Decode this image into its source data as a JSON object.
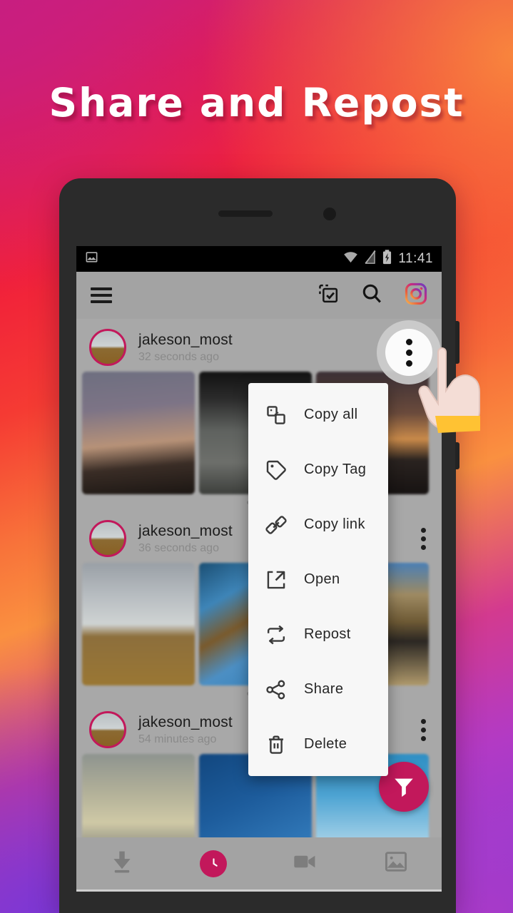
{
  "promo": {
    "headline": "Share and Repost",
    "background_colors": {
      "magenta": "#c9207f",
      "red": "#f1213a",
      "orange": "#fa9040",
      "purple": "#7436d6",
      "violet": "#b33ac4"
    }
  },
  "theme": {
    "accent": "#c2185b",
    "screen_bg": "#a8a8a8",
    "toolbar_bg": "#a3a3a3",
    "menu_bg": "#f7f7f7",
    "statusbar_bg": "#000000"
  },
  "statusbar": {
    "time": "11:41",
    "left_icons": [
      {
        "name": "image-notification-icon",
        "glyph": "image"
      }
    ],
    "right_icons": [
      {
        "name": "wifi-icon",
        "glyph": "wifi"
      },
      {
        "name": "signal-off-icon",
        "glyph": "signal-slash"
      },
      {
        "name": "battery-charging-icon",
        "glyph": "battery-bolt"
      }
    ]
  },
  "toolbar": {
    "menu_label": "Menu",
    "actions": [
      {
        "name": "select-all-icon",
        "label": "Select all"
      },
      {
        "name": "search-icon",
        "label": "Search"
      },
      {
        "name": "instagram-icon",
        "label": "Instagram"
      }
    ]
  },
  "feed": {
    "posts": [
      {
        "username": "jakeson_most",
        "time": "32 seconds ago",
        "thumbnails": [
          {
            "name": "thumb-powerlines-dusk",
            "css": "linear-gradient(175deg,#6e6f80 0%,#7d7486 30%,#b79278 58%,#3a2d26 76%,#1b1613 100%)"
          },
          {
            "name": "thumb-dark-grey",
            "css": "linear-gradient(180deg,#131313 0%,#2b2b2b 22%,#5f625f 48%,#6d6f6b 74%,#3d3f3c 100%)"
          },
          {
            "name": "thumb-sunset-road",
            "css": "linear-gradient(180deg,#3b3036 0%,#6b4b3c 34%,#c98a4a 55%,#2a2320 72%,#171312 100%)"
          }
        ]
      },
      {
        "username": "jakeson_most",
        "time": "36 seconds ago",
        "thumbnails": [
          {
            "name": "thumb-beach-desert",
            "css": "linear-gradient(180deg,#9aa0a6 0%,#b9bec2 28%,#cfd3d3 50%,#8d6f3c 60%,#9a7734 100%)"
          },
          {
            "name": "thumb-tree-blue-sky",
            "css": "linear-gradient(150deg,#1b4f74 0%,#3e85b8 26%,#7a5a2c 46%,#4c8fc4 66%,#2f7bb3 100%)"
          },
          {
            "name": "thumb-desert-dune",
            "css": "linear-gradient(180deg,#4a7fb5 0%,#9e8a62 26%,#6e5a35 48%,#2b2723 64%,#b09a6c 100%)"
          }
        ]
      },
      {
        "username": "jakeson_most",
        "time": "54 minutes ago",
        "thumbnails": [
          {
            "name": "thumb-hazy-sky",
            "css": "linear-gradient(180deg,#8e948f 0%,#b3b199 32%,#cfc9a6 56%,#7d7f79 82%,#55554f 100%)"
          },
          {
            "name": "thumb-deep-blue",
            "css": "linear-gradient(155deg,#12477f 0%,#1d5c9c 40%,#2e74b4 72%,#3c84c2 100%)"
          },
          {
            "name": "thumb-clouds-blue",
            "css": "linear-gradient(180deg,#2f8fc4 0%,#4ea4d3 34%,#8ec6e3 62%,#bfdceb 84%,#6fb2d8 100%)"
          }
        ]
      }
    ]
  },
  "popup_menu": {
    "items": [
      {
        "label": "Copy all",
        "icon": "copy-all-icon"
      },
      {
        "label": "Copy Tag",
        "icon": "tag-icon"
      },
      {
        "label": "Copy link",
        "icon": "link-icon"
      },
      {
        "label": "Open",
        "icon": "open-external-icon"
      },
      {
        "label": "Repost",
        "icon": "repost-icon"
      },
      {
        "label": "Share",
        "icon": "share-icon"
      },
      {
        "label": "Delete",
        "icon": "trash-icon"
      }
    ]
  },
  "fab": {
    "name": "filter-fab",
    "label": "Filter"
  },
  "bottomnav": {
    "items": [
      {
        "name": "nav-downloads",
        "label": "Downloads",
        "icon": "download-icon",
        "active": false
      },
      {
        "name": "nav-history",
        "label": "History",
        "icon": "clock-icon",
        "active": true
      },
      {
        "name": "nav-videos",
        "label": "Videos",
        "icon": "video-icon",
        "active": false
      },
      {
        "name": "nav-photos",
        "label": "Photos",
        "icon": "gallery-icon",
        "active": false
      }
    ]
  },
  "overflow_target": {
    "name": "post-overflow-button",
    "label": "More options"
  }
}
